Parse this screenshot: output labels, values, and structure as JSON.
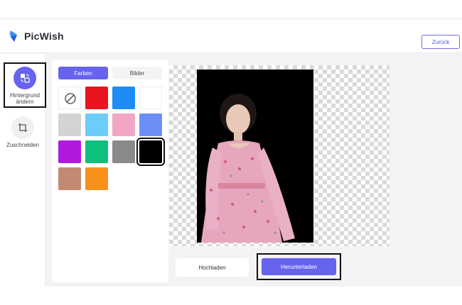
{
  "header": {
    "brand": "PicWish",
    "back_label": "Zurück"
  },
  "sidebar": {
    "items": [
      {
        "label": "Hintergrund ändern",
        "icon": "background-change-icon",
        "active": true
      },
      {
        "label": "Zuschneiden",
        "icon": "crop-icon",
        "active": false
      }
    ]
  },
  "panel": {
    "tabs": [
      {
        "label": "Farben",
        "active": true
      },
      {
        "label": "Bilder",
        "active": false
      }
    ],
    "swatches": [
      {
        "name": "none",
        "color": "#ffffff",
        "icon": "no-color-icon"
      },
      {
        "name": "red",
        "color": "#e8141f"
      },
      {
        "name": "blue",
        "color": "#1f8bf5"
      },
      {
        "name": "white",
        "color": "#ffffff"
      },
      {
        "name": "light-gray",
        "color": "#d3d3d3"
      },
      {
        "name": "sky-blue",
        "color": "#6dcdfa"
      },
      {
        "name": "pink",
        "color": "#f2a6c6"
      },
      {
        "name": "periwinkle",
        "color": "#6b8ff7"
      },
      {
        "name": "purple",
        "color": "#b01adf"
      },
      {
        "name": "green",
        "color": "#0bc17b"
      },
      {
        "name": "gray",
        "color": "#8a8a8a"
      },
      {
        "name": "black",
        "color": "#000000",
        "selected": true
      },
      {
        "name": "brown",
        "color": "#c28a72"
      },
      {
        "name": "orange",
        "color": "#f7911c"
      }
    ]
  },
  "actions": {
    "upload_label": "Hochladen",
    "download_label": "Herunterladen"
  },
  "colors": {
    "accent": "#6663ee"
  }
}
